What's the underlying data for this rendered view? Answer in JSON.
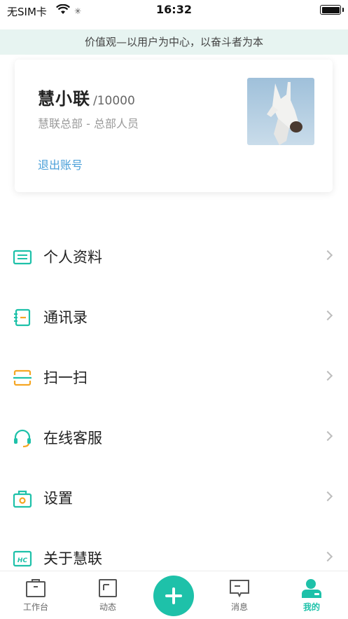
{
  "status_bar": {
    "carrier": "无SIM卡",
    "time": "16:32",
    "wifi_icon": "wifi-icon",
    "battery_icon": "battery-icon"
  },
  "slogan": "价值观—以用户为中心，以奋斗者为本",
  "profile": {
    "name": "慧小联",
    "user_id": "/10000",
    "department": "慧联总部 - 总部人员",
    "logout_label": "退出账号"
  },
  "menu": {
    "items": [
      {
        "label": "个人资料",
        "icon": "profile-card-icon"
      },
      {
        "label": "通讯录",
        "icon": "contacts-book-icon"
      },
      {
        "label": "扫一扫",
        "icon": "scan-icon"
      },
      {
        "label": "在线客服",
        "icon": "headset-icon"
      },
      {
        "label": "设置",
        "icon": "settings-case-icon"
      },
      {
        "label": "关于慧联",
        "icon": "hc-logo-icon"
      }
    ]
  },
  "tab_bar": {
    "tabs": [
      {
        "label": "工作台",
        "icon": "workbench-icon"
      },
      {
        "label": "动态",
        "icon": "news-icon"
      },
      {
        "label": "消息",
        "icon": "message-icon"
      },
      {
        "label": "我的",
        "icon": "user-icon"
      }
    ],
    "add_icon": "plus-icon",
    "active_tab": "我的"
  },
  "colors": {
    "accent": "#1ec1a9",
    "orange": "#f5a623",
    "link": "#4a9fd8",
    "banner_bg": "#e7f4f1"
  }
}
